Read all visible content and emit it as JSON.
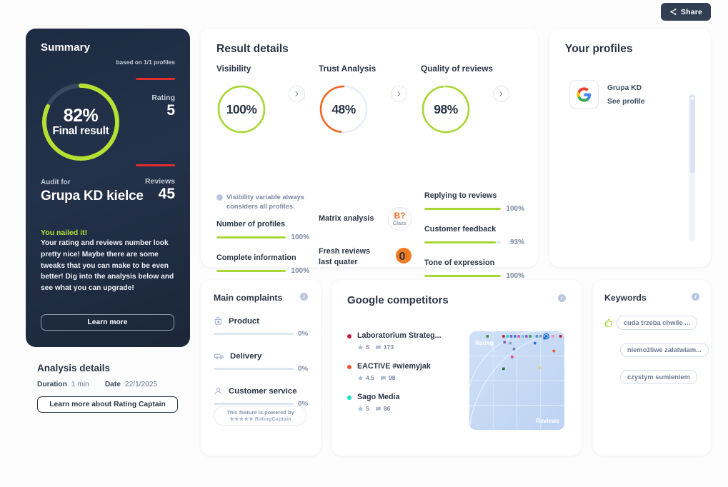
{
  "topbar": {
    "share_label": "Share",
    "share_icon": "share-icon"
  },
  "summary": {
    "title": "Summary",
    "based_on": "based on 1/1 profiles",
    "final_percent": "82%",
    "final_label": "Final result",
    "final_value": 82,
    "rating_label": "Rating",
    "rating_value": "5",
    "reviews_label": "Reviews",
    "reviews_value": "45",
    "audit_for_label": "Audit for",
    "company": "Grupa KD kielce",
    "headline": "You nailed it!",
    "body": "Your rating and reviews number look pretty nice! Maybe there are some tweaks that you can make to be even better! Dig into the analysis below and see what you can upgrade!",
    "cta": "Learn more",
    "accent": "#b7e034",
    "rule_color": "#e02d2d"
  },
  "analysis": {
    "title": "Analysis details",
    "duration_label": "Duration",
    "duration_value": "1 min",
    "date_label": "Date",
    "date_value": "22/1/2025",
    "cta": "Learn more about Rating Captain"
  },
  "results": {
    "title": "Result details",
    "metrics": [
      {
        "name": "Visibility",
        "percent": "100%",
        "value": 100,
        "color": "#a8d633",
        "chevron": "chevron-right-icon"
      },
      {
        "name": "Trust Analysis",
        "percent": "48%",
        "value": 48,
        "color": "#f26722",
        "chevron": "chevron-right-icon"
      },
      {
        "name": "Quality of reviews",
        "percent": "98%",
        "value": 98,
        "color": "#a8d633",
        "chevron": "chevron-right-icon"
      }
    ],
    "note": "Visibility variable always considers all profiles.",
    "bars_left": [
      {
        "name": "Number of profiles",
        "percent": "100%",
        "value": 100
      },
      {
        "name": "Complete information",
        "percent": "100%",
        "value": 100
      }
    ],
    "bars_right": [
      {
        "name": "Replying to reviews",
        "percent": "100%",
        "value": 100
      },
      {
        "name": "Customer feedback",
        "percent": "93%",
        "value": 93
      },
      {
        "name": "Tone of expression",
        "percent": "100%",
        "value": 100
      }
    ],
    "matrix_label": "Matrix analysis",
    "matrix_grade": "B?",
    "matrix_class": "Class",
    "fresh_label_1": "Fresh reviews",
    "fresh_label_2": "last quater",
    "fresh_value": "0"
  },
  "profiles": {
    "title": "Your profiles",
    "items": [
      {
        "name": "Grupa KD",
        "link": "See profile",
        "logo": "google-logo-icon"
      }
    ]
  },
  "complaints": {
    "title": "Main complaints",
    "info_icon": "info-icon",
    "items": [
      {
        "name": "Product",
        "percent": "0%",
        "value": 0,
        "icon": "shopping-bag-icon"
      },
      {
        "name": "Delivery",
        "percent": "0%",
        "value": 0,
        "icon": "delivery-van-icon"
      },
      {
        "name": "Customer service",
        "percent": "0%",
        "value": 0,
        "icon": "person-icon"
      }
    ],
    "powered_line1": "This feature is powered by",
    "powered_line2": "★★★★★ RatingCaptain"
  },
  "competitors": {
    "title": "Google competitors",
    "info_icon": "info-icon",
    "items": [
      {
        "name": "Laboratorium Strateg...",
        "rating": "5",
        "reviews": "173",
        "color": "#c2183b"
      },
      {
        "name": "EACTIVE #wiemyjak",
        "rating": "4.5",
        "reviews": "98",
        "color": "#f2522c"
      },
      {
        "name": "Sago Media",
        "rating": "5",
        "reviews": "86",
        "color": "#14e0c8"
      }
    ]
  },
  "keywords": {
    "title": "Keywords",
    "info_icon": "info-icon",
    "items": [
      {
        "label": "cuda trzeba chwile ...",
        "icon": "thumbs-up-icon"
      },
      {
        "label": "niemożliwe załatwiam...",
        "icon": ""
      },
      {
        "label": "czystym sumieniem",
        "icon": ""
      }
    ]
  },
  "chart_data": {
    "type": "scatter",
    "title": "Google competitors matrix",
    "xlabel": "Reviews",
    "ylabel": "Rating",
    "grid": true,
    "xlim": [
      0,
      100
    ],
    "ylim": [
      0,
      100
    ],
    "points": [
      {
        "x": 19,
        "y": 95,
        "color": "#3f8a3f"
      },
      {
        "x": 36,
        "y": 95,
        "color": "#c2183b"
      },
      {
        "x": 40,
        "y": 95,
        "color": "#14e0c8"
      },
      {
        "x": 44,
        "y": 95,
        "color": "#7a5cc6"
      },
      {
        "x": 48,
        "y": 95,
        "color": "#2b7de0"
      },
      {
        "x": 52,
        "y": 95,
        "color": "#ef4ea0"
      },
      {
        "x": 56,
        "y": 95,
        "color": "#5ac8d8"
      },
      {
        "x": 60,
        "y": 95,
        "color": "#9b59b6"
      },
      {
        "x": 64,
        "y": 95,
        "color": "#2e9e4f"
      },
      {
        "x": 71,
        "y": 95,
        "color": "#4a90d9"
      },
      {
        "x": 75,
        "y": 95,
        "color": "#888fa8"
      },
      {
        "x": 81,
        "y": 95,
        "color": "#1f6fd0"
      },
      {
        "x": 88,
        "y": 95,
        "color": "#ef8fb5"
      },
      {
        "x": 96,
        "y": 95,
        "color": "#c2183b"
      },
      {
        "x": 37,
        "y": 89,
        "color": "#7a5cc6"
      },
      {
        "x": 43,
        "y": 88,
        "color": "#8ea4c4"
      },
      {
        "x": 69,
        "y": 88,
        "color": "#2f6fd0"
      },
      {
        "x": 79,
        "y": 93,
        "color": "#2b7de0"
      },
      {
        "x": 47,
        "y": 82,
        "color": "#6f7fb0"
      },
      {
        "x": 89,
        "y": 80,
        "color": "#f05a28"
      },
      {
        "x": 45,
        "y": 74,
        "color": "#ef3f7e"
      },
      {
        "x": 36,
        "y": 62,
        "color": "#2f6b2f"
      },
      {
        "x": 74,
        "y": 63,
        "color": "#e8cf7a"
      }
    ],
    "highlight": {
      "x": 81,
      "y": 95,
      "color": "#1f6fd0",
      "style": "ring"
    }
  }
}
